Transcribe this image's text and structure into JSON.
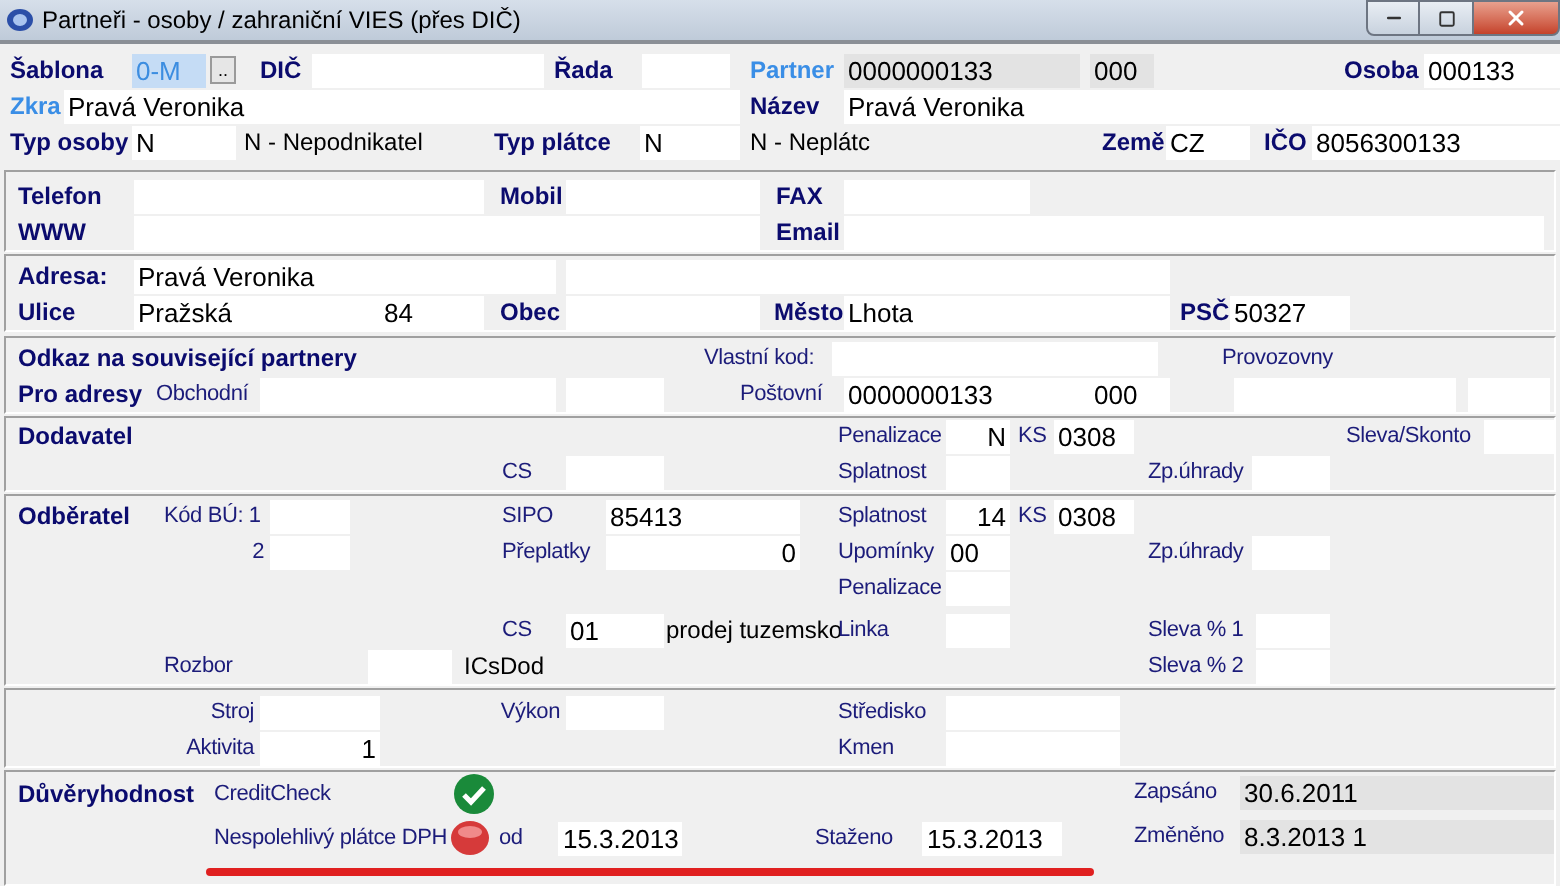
{
  "window": {
    "title": "Partneři - osoby / zahraniční VIES (přes DIČ)"
  },
  "header": {
    "sablona": {
      "label": "Šablona",
      "value": "0-M",
      "selected": true
    },
    "browse_button": "..",
    "dic": {
      "label": "DIČ"
    },
    "rada": {
      "label": "Řada"
    },
    "partner": {
      "label": "Partner",
      "value": "0000000133",
      "suffix": "000"
    },
    "osoba": {
      "label": "Osoba",
      "value": "000133"
    },
    "zkra": {
      "label": "Zkra",
      "value": "Pravá Veronika"
    },
    "nazev": {
      "label": "Název",
      "value": "Pravá Veronika"
    },
    "typ_osoby": {
      "label": "Typ osoby",
      "value": "N",
      "description": "N - Nepodnikatel"
    },
    "typ_platce": {
      "label": "Typ plátce",
      "value": "N",
      "description": "N - Neplátc"
    },
    "zeme": {
      "label": "Země",
      "value": "CZ"
    },
    "ico": {
      "label": "IČO",
      "value": "8056300133"
    }
  },
  "contact": {
    "telefon": "Telefon",
    "mobil": "Mobil",
    "fax": "FAX",
    "www": "WWW",
    "email": "Email"
  },
  "address": {
    "adresa": {
      "label": "Adresa:",
      "value": "Pravá Veronika"
    },
    "ulice": {
      "label": "Ulice",
      "value": "Pražská",
      "number": "84"
    },
    "obec": {
      "label": "Obec"
    },
    "mesto": {
      "label": "Město",
      "value": "Lhota"
    },
    "psc": {
      "label": "PSČ",
      "value": "50327"
    }
  },
  "links": {
    "title": "Odkaz na související partnery",
    "vlastni_kod": "Vlastní kod:",
    "provozovny": "Provozovny",
    "pro_adresy": "Pro adresy",
    "obchodni": "Obchodní",
    "postovni": {
      "label": "Poštovní",
      "value": "0000000133",
      "suffix": "000"
    }
  },
  "supplier": {
    "title": "Dodavatel",
    "penalizace": {
      "label": "Penalizace",
      "value": "N"
    },
    "ks": {
      "label": "KS",
      "value": "0308"
    },
    "sleva_skonto": "Sleva/Skonto",
    "cs": "CS",
    "splatnost": "Splatnost",
    "zp_uhrady": "Zp.úhrady"
  },
  "customer": {
    "title": "Odběratel",
    "kod_bu_1": "Kód BÚ: 1",
    "kod_bu_2": "2",
    "sipo": {
      "label": "SIPO",
      "value": "85413"
    },
    "splatnost": {
      "label": "Splatnost",
      "value": "14"
    },
    "ks": {
      "label": "KS",
      "value": "0308"
    },
    "preplatky": {
      "label": "Přeplatky",
      "value": "0"
    },
    "upominky": {
      "label": "Upomínky",
      "value": "00"
    },
    "zp_uhrady": "Zp.úhrady",
    "penalizace": "Penalizace",
    "cs": {
      "label": "CS",
      "value": "01",
      "description": "prodej tuzemsko"
    },
    "linka": "Linka",
    "sleva_1": "Sleva % 1",
    "rozbor": "Rozbor",
    "icsdod": "ICsDod",
    "sleva_2": "Sleva % 2"
  },
  "other": {
    "stroj": "Stroj",
    "aktivita": {
      "label": "Aktivita",
      "value": "1"
    },
    "vykon": "Výkon",
    "stredisko": "Středisko",
    "kmen": "Kmen"
  },
  "trust": {
    "title": "Důvěryhodnost",
    "creditcheck": {
      "label": "CreditCheck",
      "ok": true
    },
    "unreliable": {
      "label": "Nespolehlivý plátce DPH",
      "ok": false,
      "od_label": "od",
      "od_value": "15.3.2013",
      "highlighted": true
    },
    "stazeno": {
      "label": "Staženo",
      "value": "15.3.2013"
    },
    "zapsano": {
      "label": "Zapsáno",
      "value": "30.6.2011"
    },
    "zmeneno": {
      "label": "Změněno",
      "value": "8.3.2013 1"
    }
  }
}
